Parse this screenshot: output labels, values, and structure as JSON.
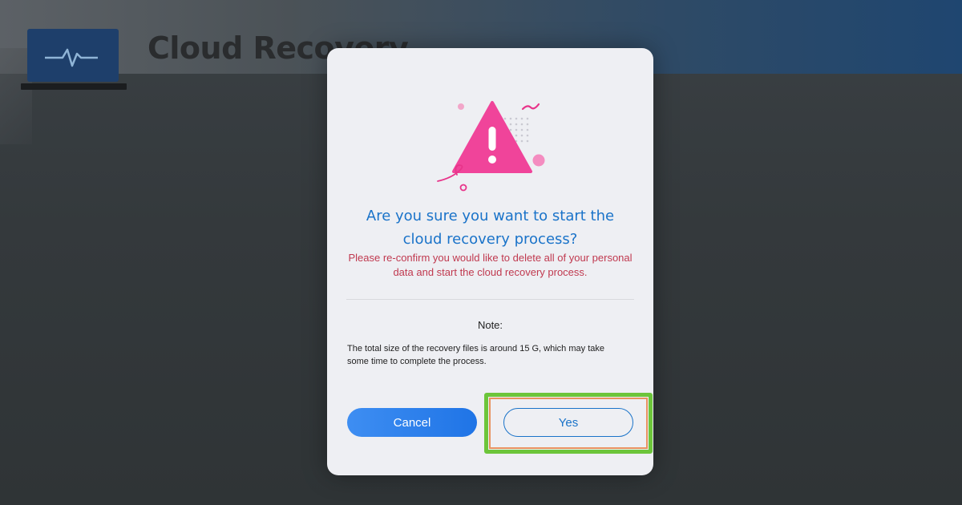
{
  "app": {
    "title": "Cloud Recovery",
    "icon": "laptop-heartbeat-icon"
  },
  "dialog": {
    "icon": "warning-triangle-icon",
    "heading_line1": "Are you sure you want to start the",
    "heading_line2": "cloud recovery process?",
    "subtext_line1": "Please re-confirm you would like to delete all of your personal",
    "subtext_line2": "data and start the cloud recovery process.",
    "note_label": "Note:",
    "note_line1": "The total size of the recovery files is around 15 G, which may take",
    "note_line2": "some time to complete the process.",
    "cancel_label": "Cancel",
    "yes_label": "Yes"
  },
  "colors": {
    "accent": "#1a73c9",
    "warning": "#f0449a",
    "subtext": "#c0394f",
    "highlight": "#6cc53a"
  }
}
